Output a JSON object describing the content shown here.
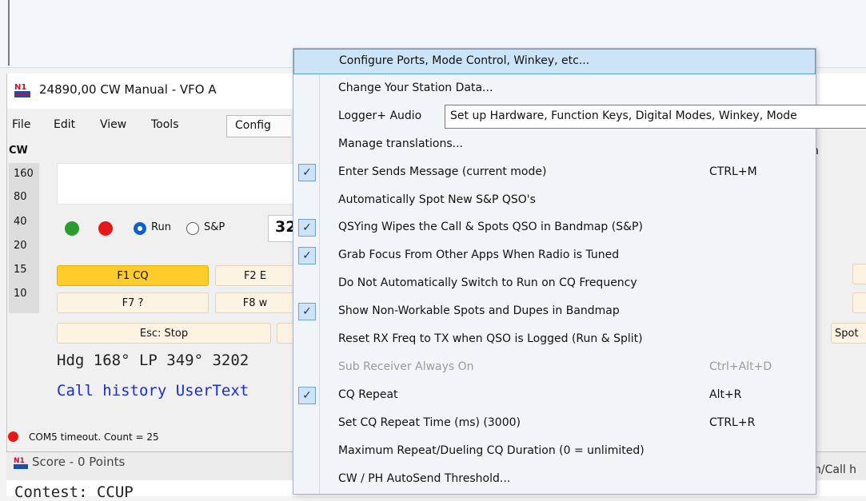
{
  "window": {
    "title": "24890,00 CW Manual - VFO A",
    "menu": [
      "File",
      "Edit",
      "View",
      "Tools",
      "Config"
    ]
  },
  "mode_label": "CW",
  "bands": [
    "160",
    "80",
    "40",
    "20",
    "15",
    "10"
  ],
  "controls": {
    "run_label": "Run",
    "sp_label": "S&P",
    "rate_value": "32"
  },
  "fkeys": {
    "f1": "F1 CQ",
    "f2": "F2 E",
    "f7": "F7 ?",
    "f8": "F8 w",
    "esc": "Esc: Stop",
    "spot": "Spot"
  },
  "info": {
    "heading": "Hdg 168° LP 349° 3202",
    "call_history": "Call history UserText"
  },
  "status": {
    "text": "COM5 timeout. Count = 25"
  },
  "score_window": {
    "title": "Score - 0 Points",
    "contest_line": "Contest: CCUP"
  },
  "right_edge": {
    "partial_n": "n",
    "call_h": "h/Call h"
  },
  "dropdown": {
    "items": [
      {
        "label": "Configure Ports, Mode Control, Winkey, etc...",
        "shortcut": "",
        "checked": false,
        "disabled": false,
        "selected": true
      },
      {
        "label": "Change Your Station Data...",
        "shortcut": "",
        "checked": false,
        "disabled": false
      },
      {
        "label": "Logger+ Audio",
        "shortcut": "",
        "checked": false,
        "disabled": false
      },
      {
        "label": "Manage translations...",
        "shortcut": "",
        "checked": false,
        "disabled": false
      },
      {
        "label": "Enter Sends Message (current mode)",
        "shortcut": "CTRL+M",
        "checked": true,
        "disabled": false
      },
      {
        "label": "Automatically Spot New S&P QSO's",
        "shortcut": "",
        "checked": false,
        "disabled": false
      },
      {
        "label": "QSYing Wipes the Call & Spots QSO in Bandmap (S&P)",
        "shortcut": "",
        "checked": true,
        "disabled": false
      },
      {
        "label": "Grab Focus From Other Apps When Radio is Tuned",
        "shortcut": "",
        "checked": true,
        "disabled": false
      },
      {
        "label": "Do Not Automatically Switch to Run on CQ Frequency",
        "shortcut": "",
        "checked": false,
        "disabled": false
      },
      {
        "label": "Show Non-Workable Spots and Dupes in Bandmap",
        "shortcut": "",
        "checked": true,
        "disabled": false
      },
      {
        "label": "Reset RX Freq to TX when QSO is Logged (Run & Split)",
        "shortcut": "",
        "checked": false,
        "disabled": false
      },
      {
        "label": "Sub Receiver Always On",
        "shortcut": "Ctrl+Alt+D",
        "checked": false,
        "disabled": true
      },
      {
        "label": "CQ Repeat",
        "shortcut": "Alt+R",
        "checked": true,
        "disabled": false
      },
      {
        "label": "Set CQ Repeat Time (ms) (3000)",
        "shortcut": "CTRL+R",
        "checked": false,
        "disabled": false
      },
      {
        "label": "Maximum Repeat/Dueling CQ Duration (0 = unlimited)",
        "shortcut": "",
        "checked": false,
        "disabled": false
      },
      {
        "label": "CW / PH AutoSend Threshold...",
        "shortcut": "",
        "checked": false,
        "disabled": false
      }
    ]
  },
  "tooltip": {
    "text": "Set up Hardware, Function Keys, Digital Modes, Winkey, Mode"
  }
}
